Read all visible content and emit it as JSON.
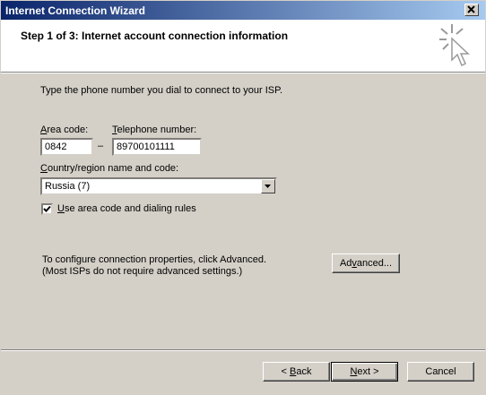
{
  "window": {
    "title": "Internet Connection Wizard",
    "close_glyph": "×"
  },
  "header": {
    "title": "Step 1 of 3: Internet account connection information",
    "icon": "cursor-sparkle-icon"
  },
  "body": {
    "instruction": "Type the phone number you dial to connect to your ISP.",
    "area_code": {
      "label_underlined": "A",
      "label_rest": "rea code:",
      "value": "0842"
    },
    "separator": "–",
    "telephone": {
      "label_underlined": "T",
      "label_rest": "elephone number:",
      "value": "89700101111"
    },
    "country": {
      "label_underlined": "C",
      "label_rest": "ountry/region name and code:",
      "selected": "Russia (7)"
    },
    "use_rules": {
      "checked": true,
      "label_underlined": "U",
      "label_rest": "se area code and dialing rules"
    },
    "advanced_info_line1": "To configure connection properties, click Advanced.",
    "advanced_info_line2": "(Most ISPs do not require advanced settings.)",
    "advanced_button": {
      "pre": "Ad",
      "underlined": "v",
      "post": "anced..."
    }
  },
  "footer": {
    "back": {
      "pre": "< ",
      "underlined": "B",
      "post": "ack"
    },
    "next": {
      "pre": "",
      "underlined": "N",
      "post": "ext >"
    },
    "cancel": "Cancel"
  }
}
